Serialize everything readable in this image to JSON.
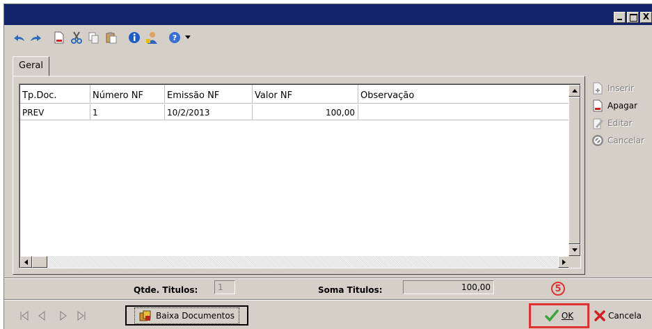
{
  "window": {
    "controls": {
      "minimize": "_",
      "maximize": "□",
      "close": "X"
    }
  },
  "toolbar": {
    "icons": [
      "undo-icon",
      "redo-icon",
      "new-document-icon",
      "cut-icon",
      "copy-icon",
      "paste-icon",
      "info-icon",
      "user-icon",
      "help-icon",
      "dropdown-arrow-icon"
    ]
  },
  "tabs": [
    {
      "label": "Geral"
    }
  ],
  "grid": {
    "columns": [
      "Tp.Doc.",
      "Número NF",
      "Emissão NF",
      "Valor NF",
      "Observação"
    ],
    "rows": [
      {
        "tp_doc": "PREV",
        "numero_nf": "1",
        "emissao_nf": "10/2/2013",
        "valor_nf": "100,00",
        "observacao": ""
      }
    ]
  },
  "side_actions": {
    "inserir": "Inserir",
    "apagar": "Apagar",
    "editar": "Editar",
    "cancelar": "Cancelar"
  },
  "totals": {
    "qtde_label": "Qtde. Titulos:",
    "qtde_value": "1",
    "soma_label": "Soma Titulos:",
    "soma_value": "100,00"
  },
  "bottom": {
    "baixa_label": "Baixa Documentos",
    "ok_label": "OK",
    "cancela_label": "Cancela",
    "step_badge": "5"
  },
  "colors": {
    "titlebar": "#14246b",
    "highlight": "#e03030",
    "window_bg": "#d4d0c8"
  }
}
